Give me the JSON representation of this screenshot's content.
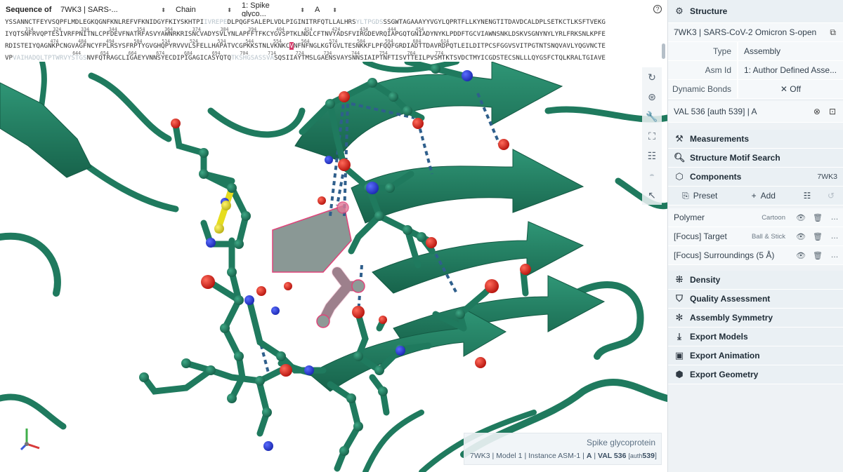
{
  "sequence": {
    "label": "Sequence of",
    "entity_select": "7WK3 | SARS-...",
    "mode_select": "Chain",
    "polymer_select": "1: Spike glyco...",
    "chain_select": "A",
    "help_icon": "question-circle-icon",
    "lines": [
      {
        "id": "l1",
        "parts": [
          {
            "t": "YSSANNCTFEYVSQPFLMDLEGKQGNFKNLREFVFKNIDGYFKIYSKHTPI",
            "c": ""
          },
          {
            "t": "IVREPE",
            "c": "g"
          },
          {
            "t": "DLPQGFSALEPLVDLPIGINITRFQTLLALHRS",
            "c": ""
          },
          {
            "t": "YLTPGDS",
            "c": "g"
          },
          {
            "t": "SSGWTAGAAAYYVGYLQPRTFLLKYNENGTITDAVDCALDPLSETKCTLKSFTVEKG",
            "c": ""
          }
        ]
      },
      {
        "id": "l2",
        "parts": [
          {
            "t": "IYQTSNFRVQPTESIVRFPNITNLCPFDEVFNATRFASVYAWNRKRISNCVADYSVLYNLAPFFTFKCYGVSPTKLNDLCFTNVYADSFVIRGDEVRQIAPGQTGNIADYNYKLPDDFTGCVIAWNSNKLDSKVSGNYNYLYRLFRKSNLKPFE",
            "c": ""
          }
        ]
      },
      {
        "id": "l3",
        "parts": [
          {
            "t": "RDISTEIYQAGNKPCNGVAGFNCYFPLRSYSFRPTYGVGHQPYRVVVLSFELLHAPATVCGPKKSTNLVKNKC",
            "c": ""
          },
          {
            "t": "V",
            "c": "hl"
          },
          {
            "t": "NFNFNGLKGTGVLTESNKKFLPFQQFGRDIADTTDAVRDPQTLEILDITPCSFGGVSVITPGTNTSNQVAVLYQGVNCTE",
            "c": ""
          }
        ]
      },
      {
        "id": "l4",
        "parts": [
          {
            "t": "VP",
            "c": ""
          },
          {
            "t": "VAIHADQLTPTWRVYSTGS",
            "c": "g"
          },
          {
            "t": "NVFQTRAGCLIGAEYVNNSYECDIPIGAGICASYQTQ",
            "c": ""
          },
          {
            "t": "TKSHGSASSVA",
            "c": "g"
          },
          {
            "t": "SQSIIAYTMSLGAENSVAYSNNSIAIPTNFTISVTTEILPVSMTKTSVDCTMYICGDSTECSNLLLQYGSFCTQLKRALTGIAVE",
            "c": ""
          }
        ]
      }
    ],
    "numbers": [
      {
        "id": "n1",
        "text": "         314       324       334       344       354       364       374       384       394       404       414       424       434       444       454"
      },
      {
        "id": "n2",
        "text": "                  474       484       494       504       514       524       534       544       554       564       574       584       594       604       614"
      },
      {
        "id": "n3",
        "text": "                          644       654       664       674       684       694       704       714       724       734       744       754       764       774"
      }
    ]
  },
  "viewport": {
    "controls": [
      {
        "name": "reset-camera-icon",
        "glyph": "↻",
        "enabled": true
      },
      {
        "name": "screenshot-icon",
        "glyph": "⊛",
        "enabled": true
      },
      {
        "name": "tools-wrench-icon",
        "glyph": "🔧",
        "enabled": true
      },
      {
        "name": "fullscreen-icon",
        "glyph": "⛶",
        "enabled": true
      },
      {
        "name": "settings-sliders-icon",
        "glyph": "☷",
        "enabled": true
      },
      {
        "name": "xr-headset-icon",
        "glyph": "◓",
        "enabled": false
      },
      {
        "name": "select-mode-cursor-icon",
        "glyph": "↖",
        "enabled": true
      }
    ],
    "info": {
      "title": "Spike glycoprotein",
      "entry": "7WK3",
      "model": "Model 1",
      "instance": "Instance ASM-1",
      "chain": "A",
      "residue": "VAL 536",
      "auth_prefix": "[auth",
      "auth_num": "539",
      "auth_suffix": "]",
      "sep": "|"
    },
    "colors": {
      "protein": "#1f7a5e",
      "protein_light": "#2e8f70",
      "oxygen": "#d8241c",
      "nitrogen": "#2336d8",
      "sulfur": "#e6dd1e",
      "hbond": "#2f5f8c",
      "focus": "#7a8a86",
      "focus_outline": "#e0447a"
    }
  },
  "structure": {
    "title": "Structure",
    "entry_name": "7WK3 | SARS-CoV-2 Omicron S-open",
    "copy_icon": "copy-icon",
    "type_key": "Type",
    "type_value": "Assembly",
    "asm_key": "Asm Id",
    "asm_value": "1: Author Defined Asse...",
    "bonds_key": "Dynamic Bonds",
    "bonds_value": "Off",
    "focus_label": "VAL 536 [auth 539] | A"
  },
  "sections": {
    "measurements": "Measurements",
    "motif": "Structure Motif Search",
    "components": "Components",
    "components_entry": "7WK3",
    "density": "Density",
    "quality": "Quality Assessment",
    "symmetry": "Assembly Symmetry",
    "export_models": "Export Models",
    "export_animation": "Export Animation",
    "export_geometry": "Export Geometry"
  },
  "components": {
    "preset": "Preset",
    "add": "Add",
    "items": [
      {
        "name": "Polymer",
        "type": "Cartoon"
      },
      {
        "name": "[Focus] Target",
        "type": "Ball & Stick"
      },
      {
        "name": "[Focus] Surroundings (5 Å)",
        "type": ""
      }
    ]
  }
}
